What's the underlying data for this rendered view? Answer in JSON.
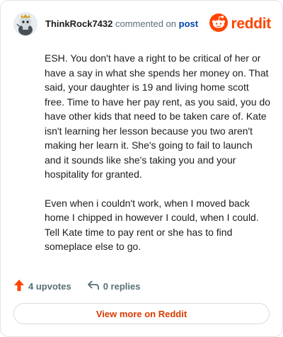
{
  "comment": {
    "username": "ThinkRock7432",
    "action_text": "commented on",
    "post_link": "post",
    "brand": "reddit",
    "paragraphs": [
      "ESH. You don't have a right to be critical of her or have a say in what she spends her money on. That said, your daughter is 19 and living home scott free. Time to have her pay rent, as you said, you do have other kids that need to be taken care of. Kate isn't learning her lesson because you two aren't making her learn it. She's going to fail to launch and it sounds like she's taking you and your hospitality for granted.",
      "Even when i couldn't work, when I moved back home I chipped in however I could, when I could. Tell Kate time to pay rent or she has to find someplace else to go."
    ],
    "upvotes_label": "4 upvotes",
    "replies_label": "0 replies",
    "view_more_label": "View more on Reddit"
  },
  "colors": {
    "accent": "#ff4500",
    "link": "#0045ac",
    "muted": "#576f76"
  },
  "icons": [
    "avatar-snoo",
    "reddit-logo-icon",
    "upvote-arrow-icon",
    "reply-arrow-icon"
  ]
}
